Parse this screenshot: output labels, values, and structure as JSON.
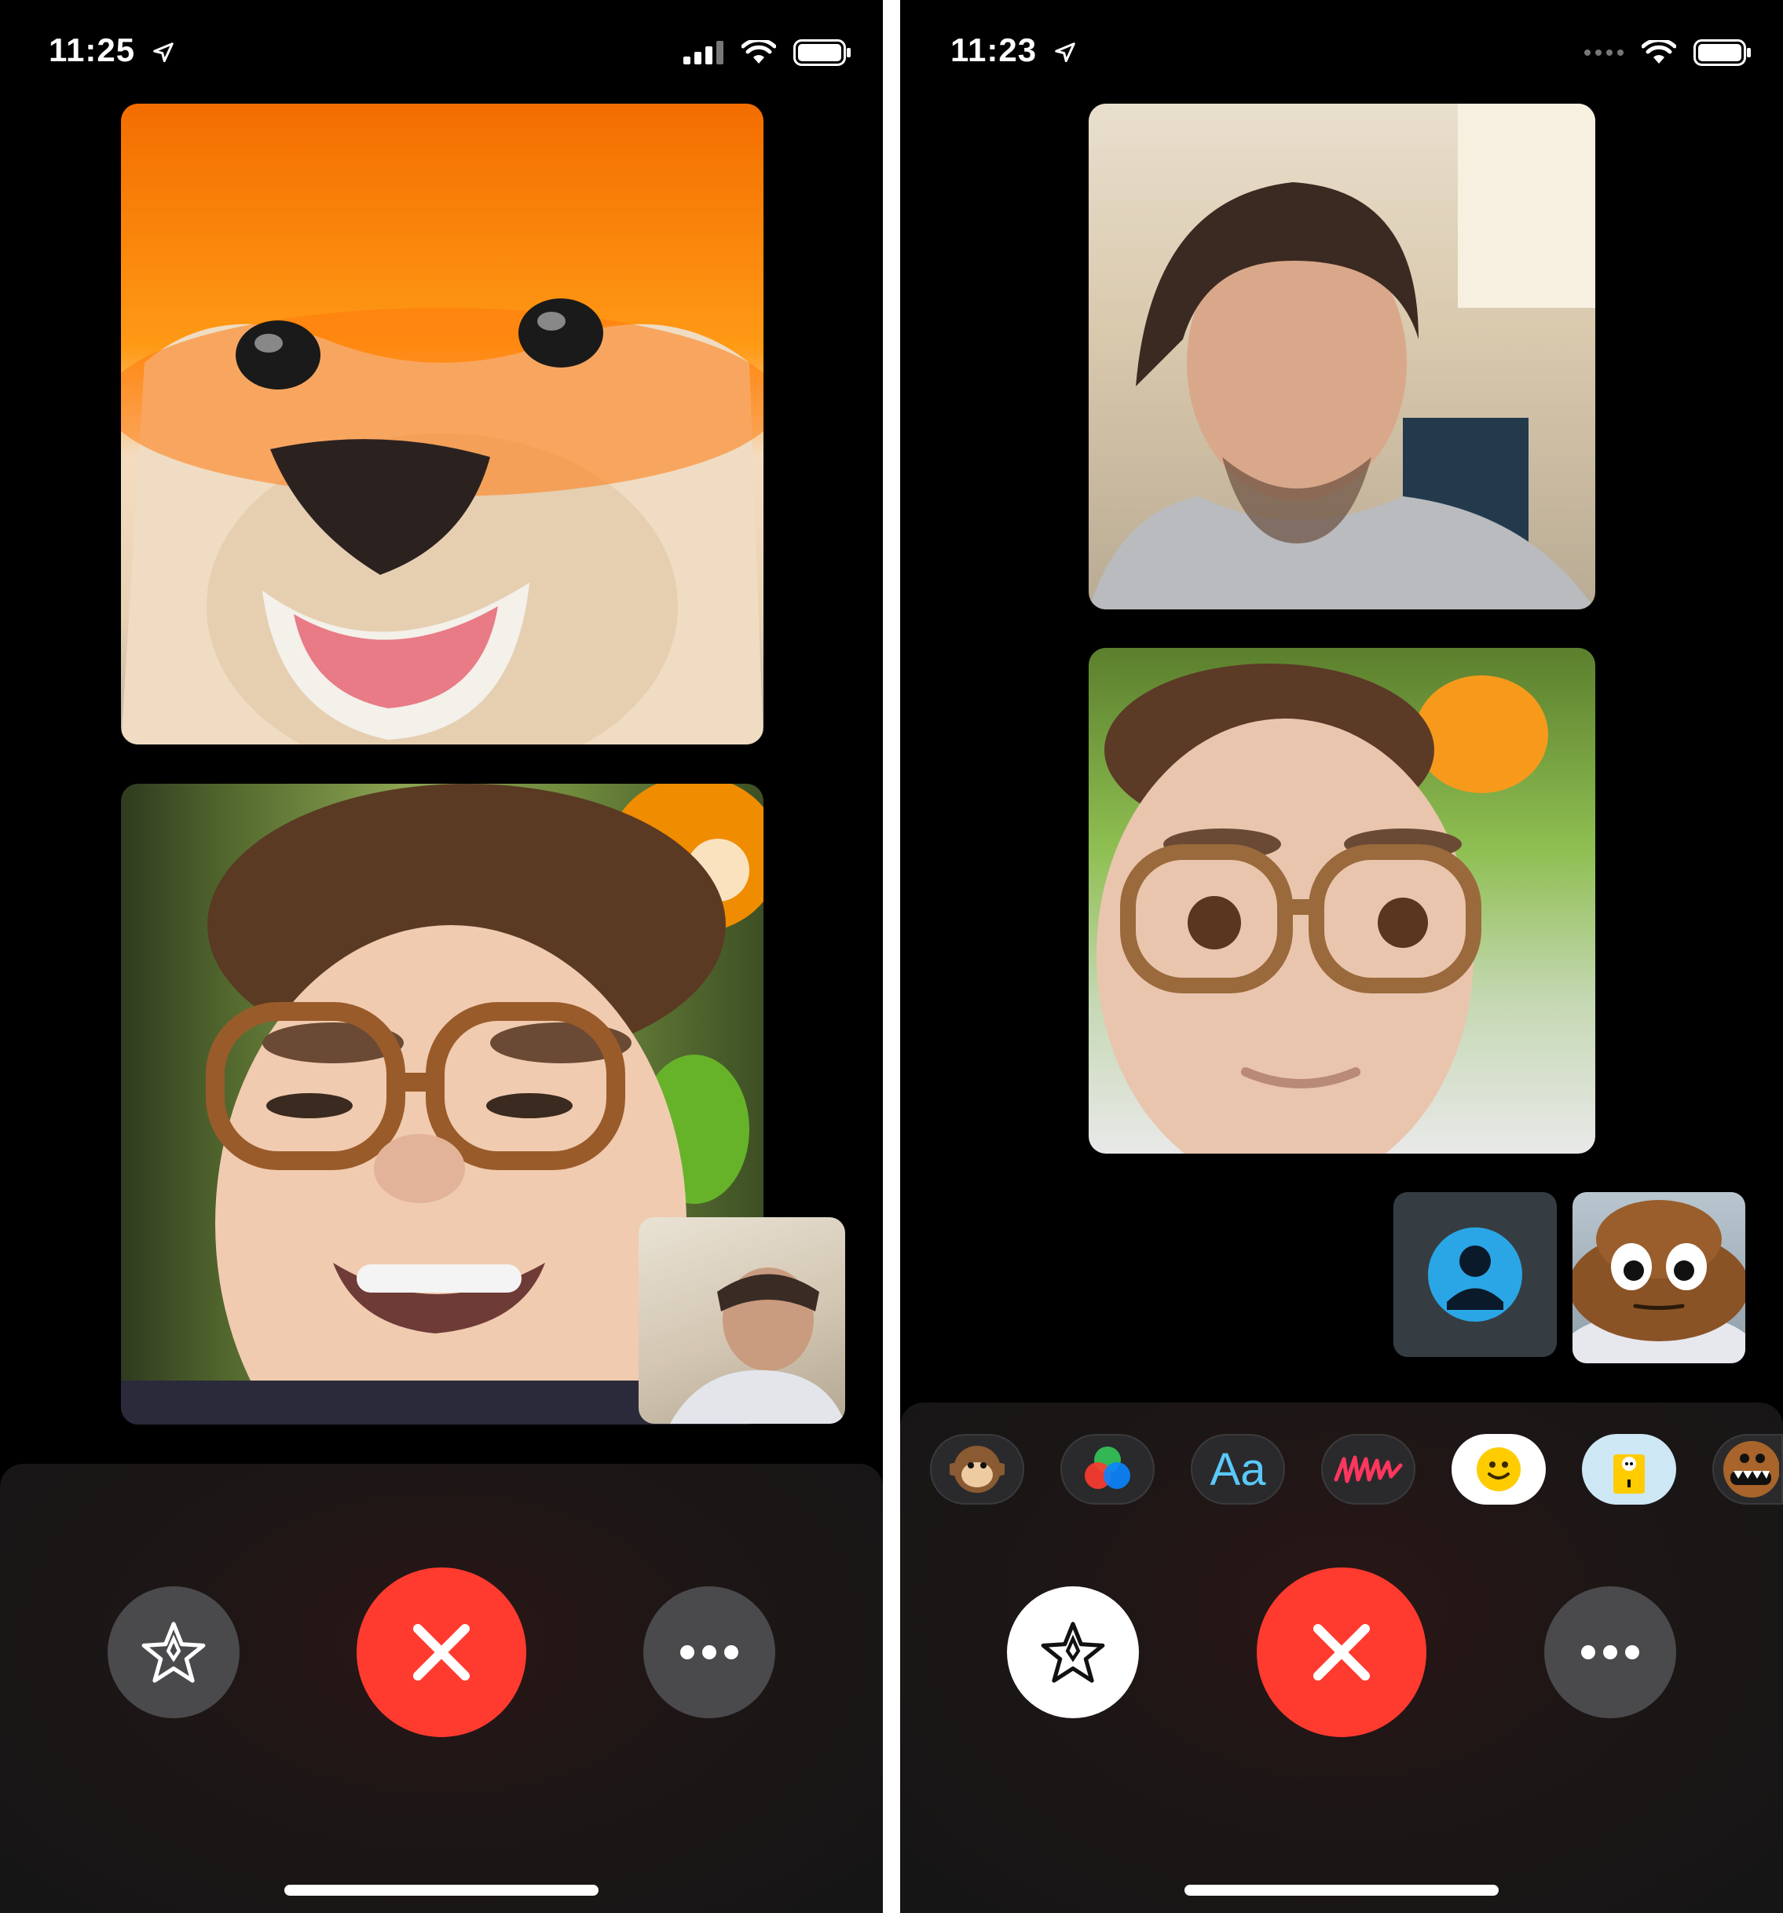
{
  "left_phone": {
    "status": {
      "time": "11:25"
    },
    "tiles": {
      "top": "fox-animoji",
      "middle": "memoji-with-stickers",
      "self_view": "camera-self-view"
    },
    "controls": [
      "effects",
      "end-call",
      "more"
    ]
  },
  "right_phone": {
    "status": {
      "time": "11:23"
    },
    "tiles": {
      "top": "camera-person",
      "middle": "memoji-with-glasses",
      "small_left": "contact-placeholder",
      "small_right": "poop-animoji"
    },
    "effects_tray": {
      "text_effect_label": "Aa",
      "items": [
        "animoji",
        "filters",
        "text",
        "shapes",
        "emoji-sticker",
        "memoji-sticker",
        "monster-animoji"
      ]
    },
    "controls": [
      "effects",
      "end-call",
      "more"
    ]
  },
  "colors": {
    "end_call": "#ff3b30",
    "control_grey": "#4a4a4c",
    "text_effect_blue": "#5ac8fa",
    "background": "#000000"
  }
}
